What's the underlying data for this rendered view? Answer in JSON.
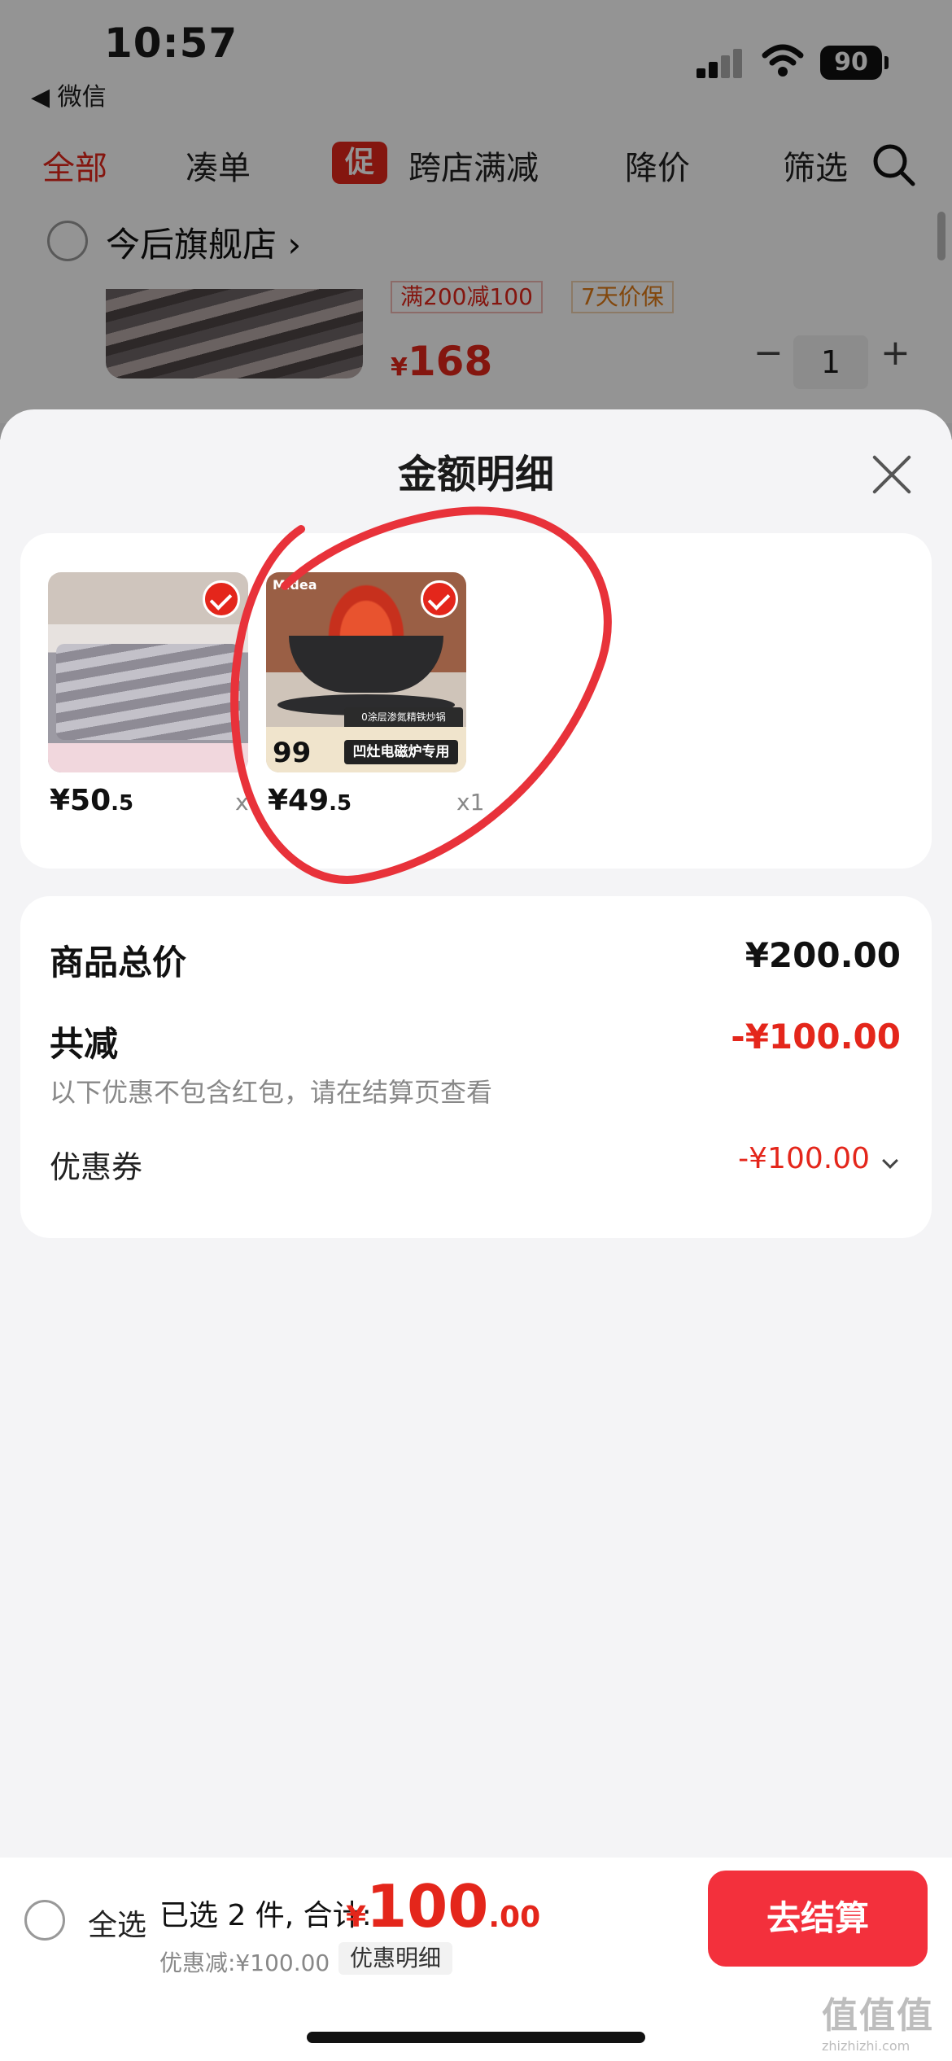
{
  "status_bar": {
    "time": "10:57",
    "back_label": "◀ 微信",
    "battery": "90"
  },
  "filters": [
    "全部",
    "凑单",
    "跨店满减",
    "降价",
    "筛选"
  ],
  "promo_tag": "促",
  "store": {
    "name": "今后旗舰店 ›"
  },
  "cart_item": {
    "tags": [
      "满200减100",
      "7天价保"
    ],
    "price_symbol": "¥",
    "price": "168",
    "quantity": "1",
    "minus": "−",
    "plus": "+"
  },
  "sheet": {
    "title": "金额明细",
    "items": [
      {
        "price_int": "¥50",
        "price_dec": ".5",
        "qty": "x1"
      },
      {
        "price_int": "¥49",
        "price_dec": ".5",
        "qty": "x1",
        "brand": "Midea",
        "badge_price": "99",
        "badge_sub": "0涂层渗氮精铁炒锅",
        "badge_text": "凹灶电磁炉专用"
      }
    ],
    "summary": {
      "total_label": "商品总价",
      "total_value": "¥200.00",
      "reduce_label": "共减",
      "reduce_value": "-¥100.00",
      "note": "以下优惠不包含红包，请在结算页查看",
      "coupon_label": "优惠券",
      "coupon_value": "-¥100.00"
    }
  },
  "bottom": {
    "select_all": "全选",
    "selected": "已选 2 件, 合计:",
    "total_symbol": "¥",
    "total_int": "100",
    "total_dec": ".00",
    "discount": "优惠减:¥100.00",
    "detail_link": "优惠明细",
    "checkout": "去结算"
  },
  "watermark": {
    "logo": "值值值",
    "url": "zhizhizhi.com"
  },
  "colors": {
    "accent": "#e4261b",
    "checkout": "#f3303c",
    "annotation": "#e8323a"
  }
}
